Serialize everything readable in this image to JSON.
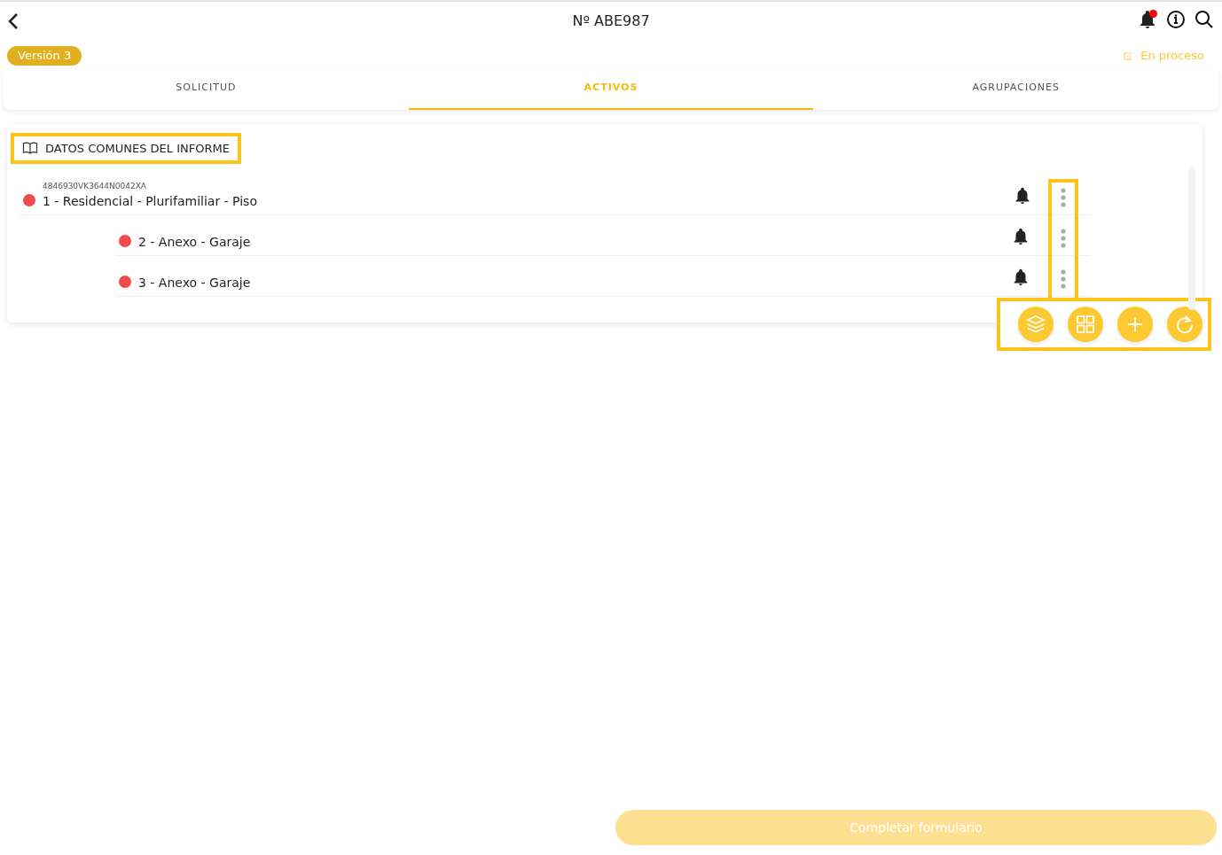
{
  "header": {
    "title": "Nº ABE987",
    "notification_unread": true
  },
  "version_badge": "Versión 3",
  "status": "En proceso",
  "tabs": [
    {
      "label": "SOLICITUD",
      "selected": false
    },
    {
      "label": "ACTIVOS",
      "selected": true
    },
    {
      "label": "AGRUPACIONES",
      "selected": false
    }
  ],
  "section": {
    "title": "DATOS COMUNES DEL INFORME",
    "highlighted": true
  },
  "assets": [
    {
      "reference": "4846930VK3644N0042XA",
      "label": "1 - Residencial - Plurifamiliar - Piso",
      "color": "#f04a4a",
      "children": [
        {
          "label": "2 - Anexo - Garaje",
          "color": "#f04a4a"
        },
        {
          "label": "3 - Anexo - Garaje",
          "color": "#f04a4a"
        }
      ]
    }
  ],
  "menus_highlighted": true,
  "actions_highlighted": true,
  "actions": [
    {
      "kind": "layers"
    },
    {
      "kind": "grid"
    },
    {
      "kind": "add"
    },
    {
      "kind": "refresh"
    }
  ],
  "submit": {
    "label": "Completar formulario",
    "disabled": true
  }
}
